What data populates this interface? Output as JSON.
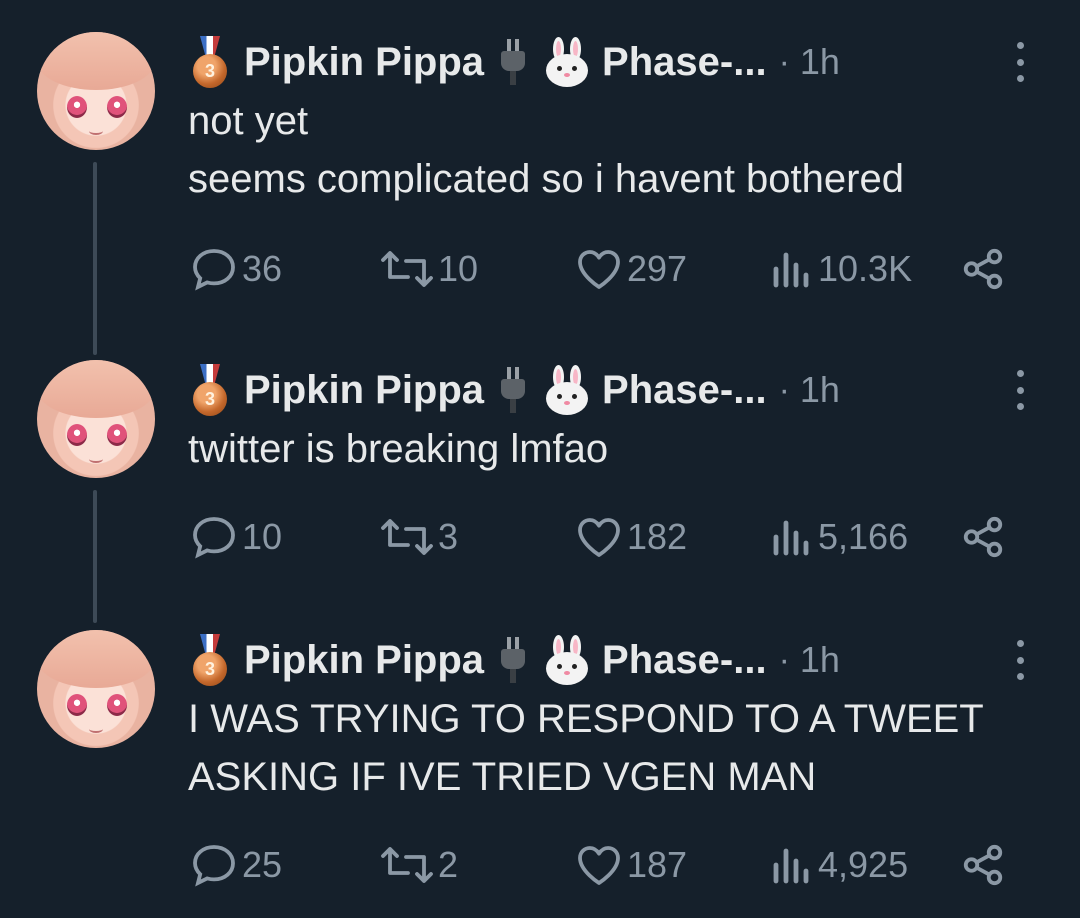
{
  "tweets": [
    {
      "name": "Pipkin Pippa",
      "medal_number": "3",
      "display_suffix": "Phase-...",
      "dot": "·",
      "time": "1h",
      "text": "not yet\nseems complicated so i havent bothered",
      "stats": {
        "replies": "36",
        "retweets": "10",
        "likes": "297",
        "views": "10.3K"
      }
    },
    {
      "name": "Pipkin Pippa",
      "medal_number": "3",
      "display_suffix": "Phase-...",
      "dot": "·",
      "time": "1h",
      "text": "twitter is breaking lmfao",
      "stats": {
        "replies": "10",
        "retweets": "3",
        "likes": "182",
        "views": "5,166"
      }
    },
    {
      "name": "Pipkin Pippa",
      "medal_number": "3",
      "display_suffix": "Phase-...",
      "dot": "·",
      "time": "1h",
      "text": "I WAS TRYING TO RESPOND TO A TWEET\nASKING IF IVE TRIED VGEN MAN",
      "stats": {
        "replies": "25",
        "retweets": "2",
        "likes": "187",
        "views": "4,925"
      }
    }
  ],
  "colors": {
    "background": "#15202b",
    "text": "#e7e9ea",
    "muted": "#8b98a5",
    "thread_line": "#3d4a57"
  },
  "icons": [
    "medal-icon",
    "plug-icon",
    "bunny-icon",
    "more-icon",
    "reply-icon",
    "retweet-icon",
    "like-icon",
    "views-icon",
    "share-icon"
  ]
}
